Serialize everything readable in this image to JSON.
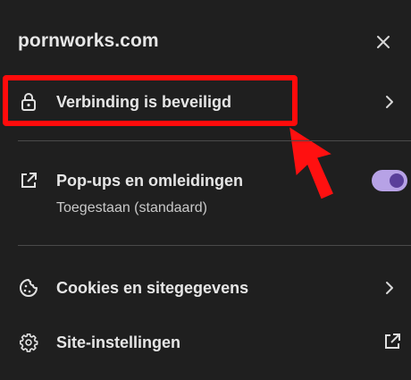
{
  "header": {
    "site": "pornworks.com",
    "close_icon": "close-icon"
  },
  "connection": {
    "label": "Verbinding is beveiligd",
    "icon": "lock-icon"
  },
  "popups": {
    "label": "Pop-ups en omleidingen",
    "status": "Toegestaan (standaard)",
    "icon": "open-in-new-icon",
    "enabled": true
  },
  "cookies": {
    "label": "Cookies en sitegegevens",
    "icon": "cookie-icon"
  },
  "settings": {
    "label": "Site-instellingen",
    "icon": "gear-icon"
  },
  "colors": {
    "background": "#1f1f1f",
    "highlight": "#ff0b0b",
    "toggle_track": "#b7a2e6",
    "toggle_knob": "#5a3f9a"
  }
}
